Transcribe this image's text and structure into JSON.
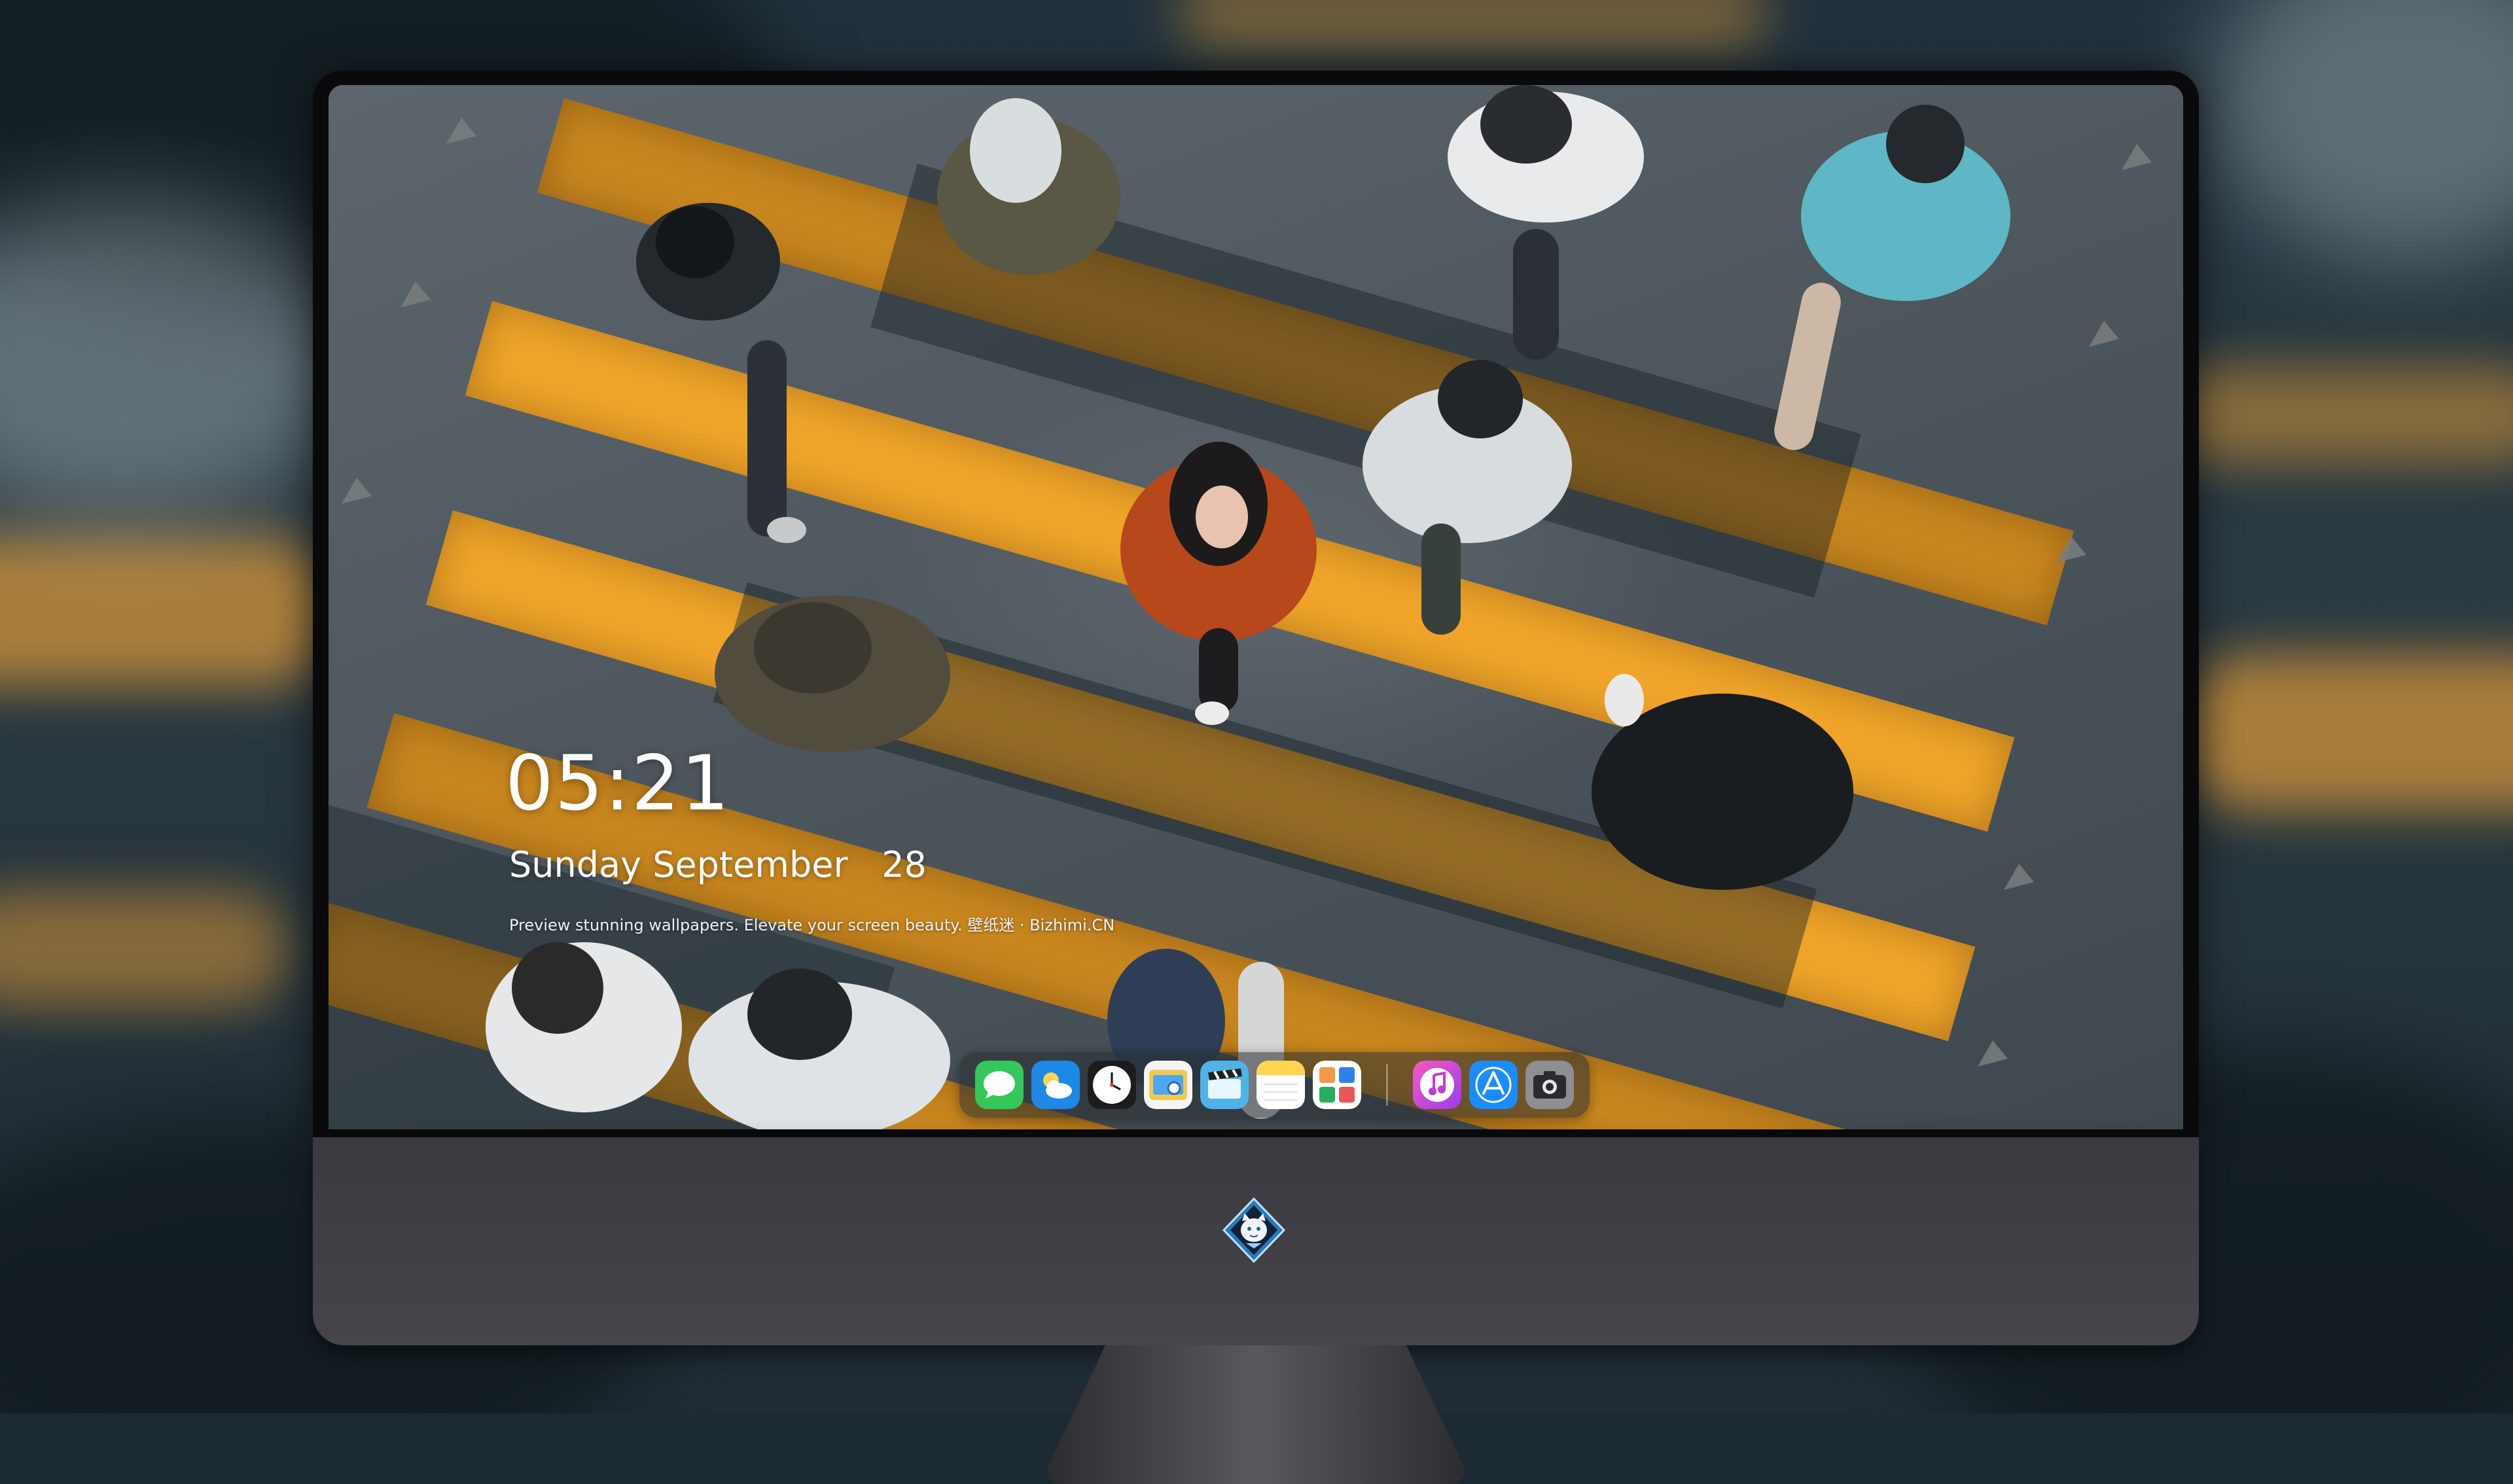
{
  "lock_screen": {
    "time": "05:21",
    "date": "Sunday September   28",
    "tagline": "Preview stunning wallpapers. Elevate your screen beauty. 壁纸迷 · Bizhimi.CN"
  },
  "dock": {
    "apps": [
      {
        "name": "messages-icon",
        "color": "#34c759"
      },
      {
        "name": "weather-icon",
        "color": "#1e88e5"
      },
      {
        "name": "clock-icon",
        "color": "#ffffff"
      },
      {
        "name": "preview-icon",
        "color": "#f2c94c"
      },
      {
        "name": "claquette-icon",
        "color": "#4fb3e8"
      },
      {
        "name": "notes-icon",
        "color": "#ffd54f"
      },
      {
        "name": "photo-grid-icon",
        "color": "#ffffff"
      }
    ],
    "recent_apps": [
      {
        "name": "itunes-icon",
        "color": "#d33ed6"
      },
      {
        "name": "app-store-icon",
        "color": "#1a8cff"
      },
      {
        "name": "screenshot-icon",
        "color": "#8e8e93"
      }
    ]
  },
  "monitor": {
    "logo": "bizhimi-cat-logo",
    "bezel_color": "#0a0a0c",
    "chin_color": "#413f45"
  }
}
